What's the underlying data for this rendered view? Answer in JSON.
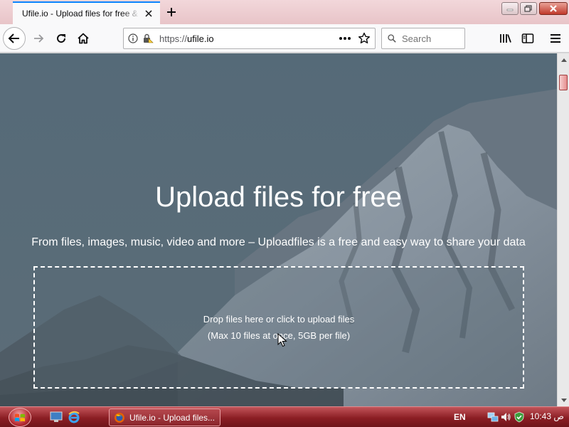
{
  "browser": {
    "tab": {
      "title": "Ufile.io - Upload files for free & "
    },
    "url": {
      "prefix": "https://",
      "host": "ufile.io"
    },
    "search": {
      "placeholder": "Search"
    }
  },
  "page": {
    "hero_title": "Upload files for free",
    "hero_subtitle": "From files, images, music, video and more – Uploadfiles is a free and easy way to share your data",
    "dropzone": {
      "line1": "Drop files here or click to upload files",
      "line2": "(Max 10 files at once, 5GB per file)"
    }
  },
  "taskbar": {
    "task_label": "Ufile.io - Upload files...",
    "language": "EN",
    "clock": "10:43 ص"
  },
  "colors": {
    "accent": "#0a84ff",
    "taskbar": "#8b1e24",
    "page_bg": "#4c5a63"
  }
}
